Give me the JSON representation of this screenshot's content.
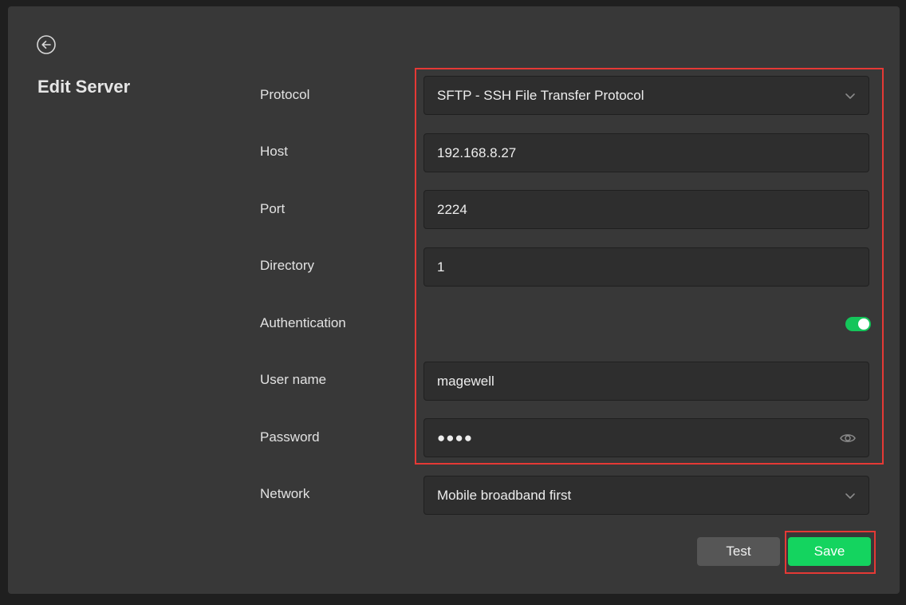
{
  "page": {
    "title": "Edit Server",
    "back_icon": "arrow-left-circle-icon"
  },
  "form": {
    "protocol": {
      "label": "Protocol",
      "value": "SFTP - SSH File Transfer Protocol"
    },
    "host": {
      "label": "Host",
      "value": "192.168.8.27"
    },
    "port": {
      "label": "Port",
      "value": "2224"
    },
    "directory": {
      "label": "Directory",
      "value": "1"
    },
    "authentication": {
      "label": "Authentication",
      "enabled": true
    },
    "username": {
      "label": "User name",
      "value": "magewell"
    },
    "password": {
      "label": "Password",
      "value": "●●●●",
      "icon": "eye-icon"
    },
    "network": {
      "label": "Network",
      "value": "Mobile broadband first"
    }
  },
  "actions": {
    "test_label": "Test",
    "save_label": "Save"
  },
  "colors": {
    "accent": "#14d45f",
    "highlight": "#e53935",
    "panel": "#383838"
  }
}
